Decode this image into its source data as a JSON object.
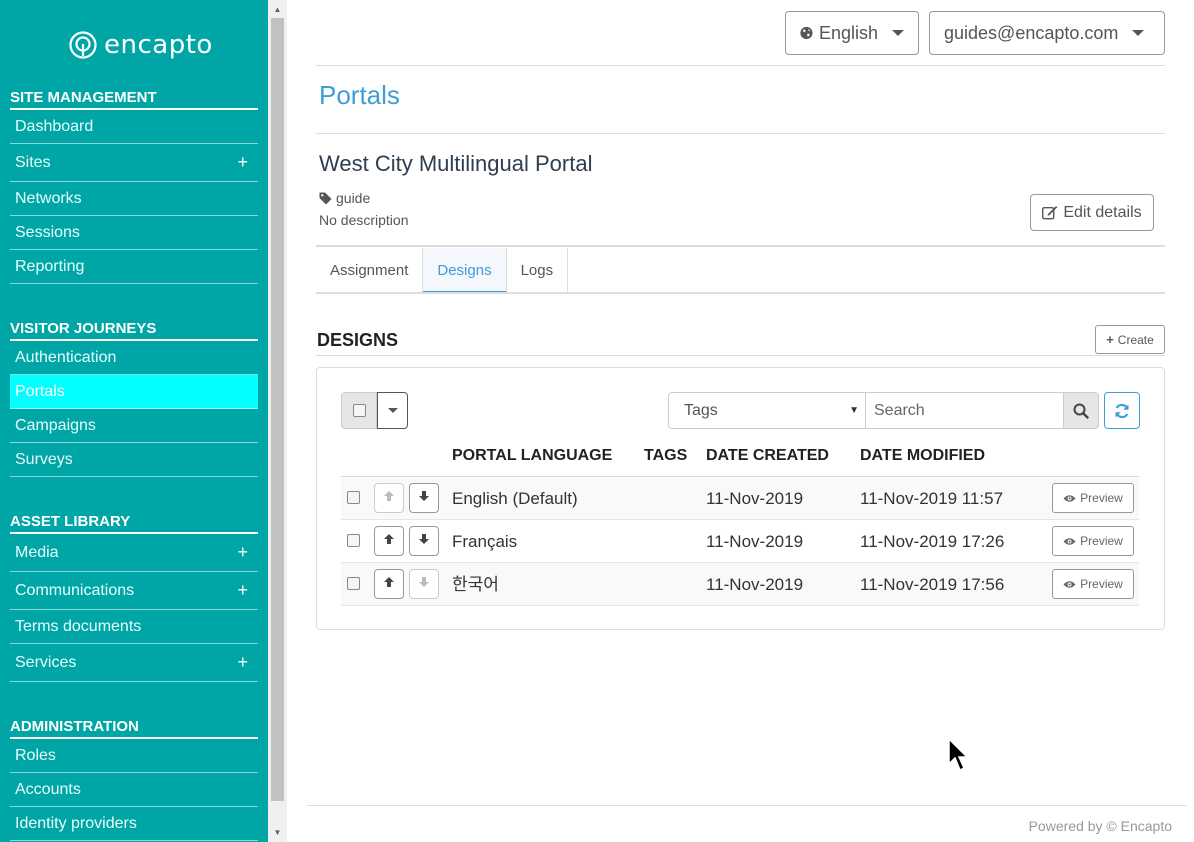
{
  "brand": {
    "logo_text": "encapto"
  },
  "sidebar": {
    "sections": [
      {
        "header": "SITE MANAGEMENT",
        "items": [
          {
            "label": "Dashboard",
            "expandable": false
          },
          {
            "label": "Sites",
            "expandable": true
          },
          {
            "label": "Networks",
            "expandable": false
          },
          {
            "label": "Sessions",
            "expandable": false
          },
          {
            "label": "Reporting",
            "expandable": false
          }
        ]
      },
      {
        "header": "VISITOR JOURNEYS",
        "items": [
          {
            "label": "Authentication",
            "expandable": false
          },
          {
            "label": "Portals",
            "expandable": false,
            "active": true
          },
          {
            "label": "Campaigns",
            "expandable": false
          },
          {
            "label": "Surveys",
            "expandable": false
          }
        ]
      },
      {
        "header": "ASSET LIBRARY",
        "items": [
          {
            "label": "Media",
            "expandable": true
          },
          {
            "label": "Communications",
            "expandable": true
          },
          {
            "label": "Terms documents",
            "expandable": false
          },
          {
            "label": "Services",
            "expandable": true
          }
        ]
      },
      {
        "header": "ADMINISTRATION",
        "items": [
          {
            "label": "Roles",
            "expandable": false
          },
          {
            "label": "Accounts",
            "expandable": false
          },
          {
            "label": "Identity providers",
            "expandable": false
          }
        ]
      }
    ],
    "plus_symbol": "+"
  },
  "topbar": {
    "language": "English",
    "user": "guides@encapto.com"
  },
  "page": {
    "title": "Portals",
    "portal_name": "West City Multilingual Portal",
    "tag": "guide",
    "description": "No description",
    "edit_label": "Edit details"
  },
  "tabs": [
    {
      "label": "Assignment",
      "active": false
    },
    {
      "label": "Designs",
      "active": true
    },
    {
      "label": "Logs",
      "active": false
    }
  ],
  "designs": {
    "title": "DESIGNS",
    "create_label": "Create",
    "tags_select": "Tags",
    "search_placeholder": "Search",
    "columns": [
      "PORTAL LANGUAGE",
      "TAGS",
      "DATE CREATED",
      "DATE MODIFIED"
    ],
    "rows": [
      {
        "language": "English (Default)",
        "tags": "",
        "created": "11-Nov-2019",
        "modified": "11-Nov-2019 11:57",
        "up_enabled": false,
        "down_enabled": true
      },
      {
        "language": "Français",
        "tags": "",
        "created": "11-Nov-2019",
        "modified": "11-Nov-2019 17:26",
        "up_enabled": true,
        "down_enabled": true
      },
      {
        "language": "한국어",
        "tags": "",
        "created": "11-Nov-2019",
        "modified": "11-Nov-2019 17:56",
        "up_enabled": true,
        "down_enabled": false
      }
    ],
    "preview_label": "Preview"
  },
  "footer": {
    "text": "Powered by © Encapto"
  },
  "colors": {
    "sidebar": "#00a6a6",
    "active_item": "#00ffff",
    "accent": "#3e9fd8"
  }
}
